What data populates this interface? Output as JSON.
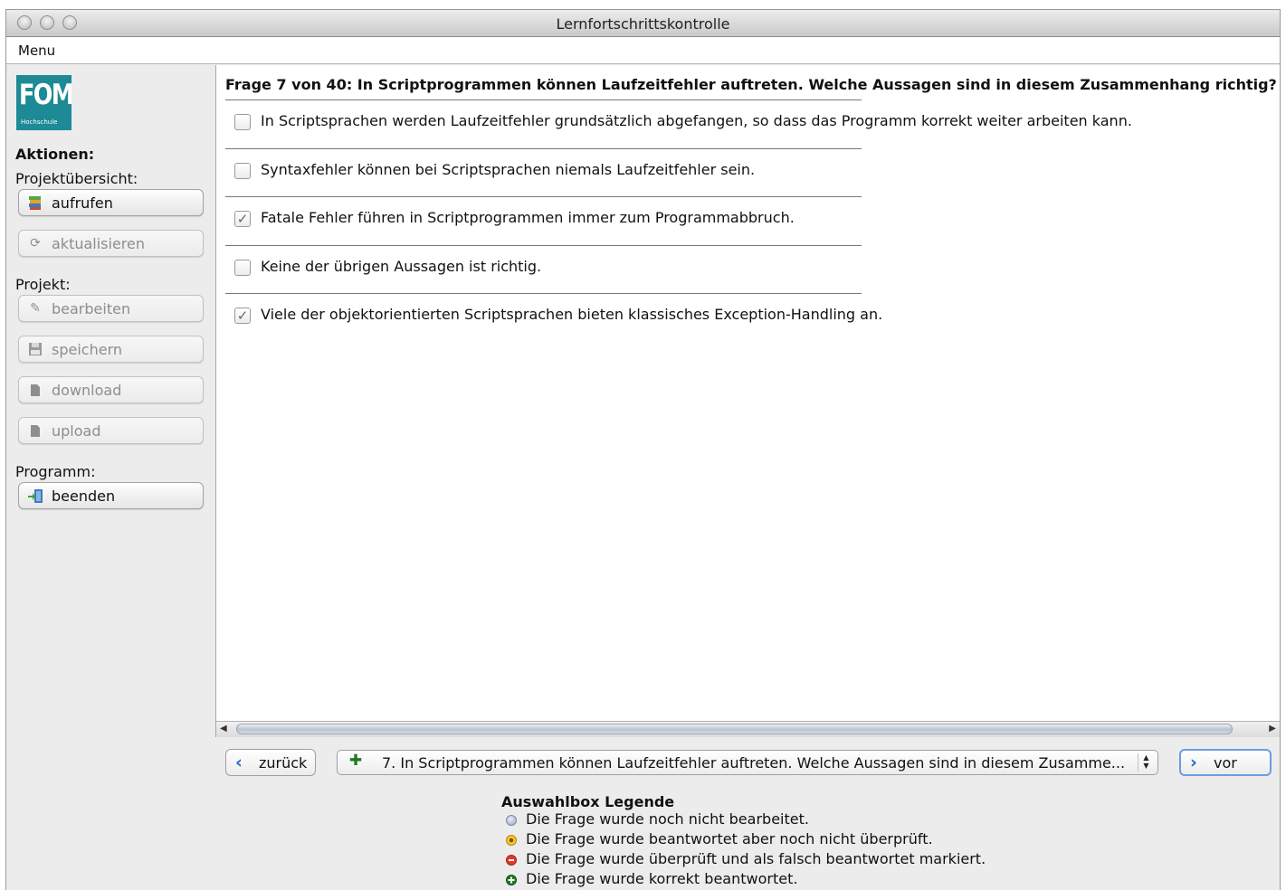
{
  "window": {
    "title": "Lernfortschrittskontrolle"
  },
  "menu": {
    "label": "Menu"
  },
  "logo": {
    "big": "FOM",
    "small": "Hochschule"
  },
  "sidebar": {
    "actions_label": "Aktionen:",
    "overview_label": "Projektübersicht:",
    "project_label": "Projekt:",
    "program_label": "Programm:",
    "buttons": {
      "call": "aufrufen",
      "refresh": "aktualisieren",
      "edit": "bearbeiten",
      "save": "speichern",
      "download": "download",
      "upload": "upload",
      "quit": "beenden"
    }
  },
  "question": {
    "text": "Frage 7 von 40: In Scriptprogrammen können Laufzeitfehler auftreten. Welche Aussagen sind in diesem Zusammenhang richtig?",
    "answers": [
      {
        "text": "In Scriptsprachen werden Laufzeitfehler grundsätzlich abgefangen, so dass das Programm korrekt weiter arbeiten kann.",
        "checked": false
      },
      {
        "text": "Syntaxfehler können bei Scriptsprachen niemals Laufzeitfehler sein.",
        "checked": false
      },
      {
        "text": "Fatale Fehler führen in Scriptprogrammen immer zum Programmabbruch.",
        "checked": true
      },
      {
        "text": "Keine der übrigen Aussagen ist richtig.",
        "checked": false
      },
      {
        "text": "Viele der objektorientierten Scriptsprachen bieten klassisches Exception-Handling an.",
        "checked": true
      }
    ]
  },
  "nav": {
    "back_label": "zurück",
    "forward_label": "vor",
    "selected_question": "7. In Scriptprogrammen können Laufzeitfehler auftreten. Welche Aussagen sind in diesem Zusamme..."
  },
  "legend": {
    "title": "Auswahlbox Legende",
    "items": [
      {
        "text": "Die Frage wurde noch nicht bearbeitet.",
        "color": "#9aa6c4"
      },
      {
        "text": "Die Frage wurde beantwortet aber noch nicht überprüft.",
        "color": "#f0b400"
      },
      {
        "text": "Die Frage wurde überprüft und als falsch beantwortet markiert.",
        "color": "#e23a2a"
      },
      {
        "text": "Die Frage wurde korrekt beantwortet.",
        "color": "#1e7a1e"
      }
    ]
  }
}
